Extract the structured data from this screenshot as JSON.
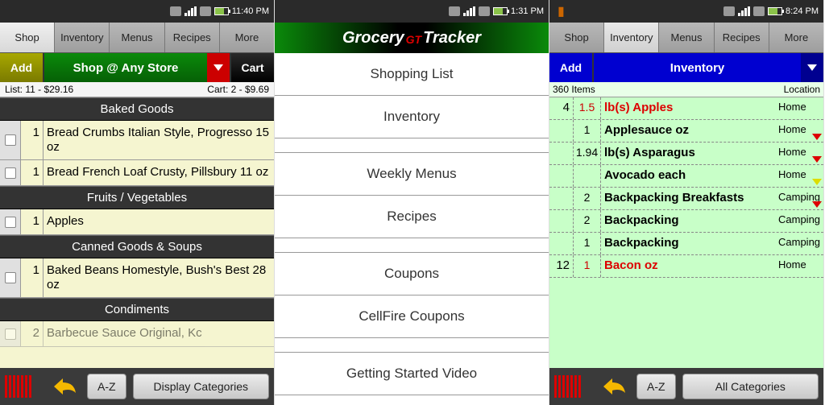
{
  "phone1": {
    "time": "11:40 PM",
    "tabs": [
      "Shop",
      "Inventory",
      "Menus",
      "Recipes",
      "More"
    ],
    "add": "Add",
    "shopAt": "Shop @ Any Store",
    "cart": "Cart",
    "listTotal": "List: 11 - $29.16",
    "cartTotal": "Cart: 2 - $9.69",
    "sec1": "Baked Goods",
    "r1": {
      "q": "1",
      "n": "Bread Crumbs Italian Style, Progresso 15 oz"
    },
    "r2": {
      "q": "1",
      "n": "Bread French Loaf Crusty, Pillsbury 11 oz"
    },
    "sec2": "Fruits / Vegetables",
    "r3": {
      "q": "1",
      "n": "Apples"
    },
    "sec3": "Canned Goods & Soups",
    "r4": {
      "q": "1",
      "n": "Baked Beans Homestyle, Bush's Best 28 oz"
    },
    "sec4": "Condiments",
    "r5": {
      "q": "2",
      "n": "Barbecue Sauce Original, Kc"
    },
    "az": "A-Z",
    "disp": "Display Categories"
  },
  "phone2": {
    "time": "1:31 PM",
    "bannerA": "Grocery",
    "bannerGT": "GT",
    "bannerB": "Tracker",
    "m1": "Shopping List",
    "m2": "Inventory",
    "m3": "Weekly Menus",
    "m4": "Recipes",
    "m5": "Coupons",
    "m6": "CellFire Coupons",
    "m7": "Getting Started Video"
  },
  "phone3": {
    "time": "8:24 PM",
    "tabs": [
      "Shop",
      "Inventory",
      "Menus",
      "Recipes",
      "More"
    ],
    "add": "Add",
    "mid": "Inventory",
    "items": "360 Items",
    "loc": "Location",
    "r1": {
      "a": "4",
      "b": "1.5",
      "n": "lb(s) Apples",
      "l": "Home"
    },
    "r2": {
      "a": "",
      "b": "1",
      "n": "Applesauce  oz",
      "l": "Home"
    },
    "r3": {
      "a": "",
      "b": "1.94",
      "n": "lb(s) Asparagus",
      "l": "Home"
    },
    "r4": {
      "a": "",
      "b": "",
      "n": "Avocado  each",
      "l": "Home"
    },
    "r5": {
      "a": "",
      "b": "2",
      "n": "Backpacking Breakfasts",
      "l": "Camping"
    },
    "r6": {
      "a": "",
      "b": "2",
      "n": "Backpacking",
      "l": "Camping"
    },
    "r7": {
      "a": "",
      "b": "1",
      "n": "Backpacking",
      "l": "Camping"
    },
    "r8": {
      "a": "12",
      "b": "1",
      "n": "Bacon  oz",
      "l": "Home"
    },
    "az": "A-Z",
    "cat": "All Categories"
  }
}
